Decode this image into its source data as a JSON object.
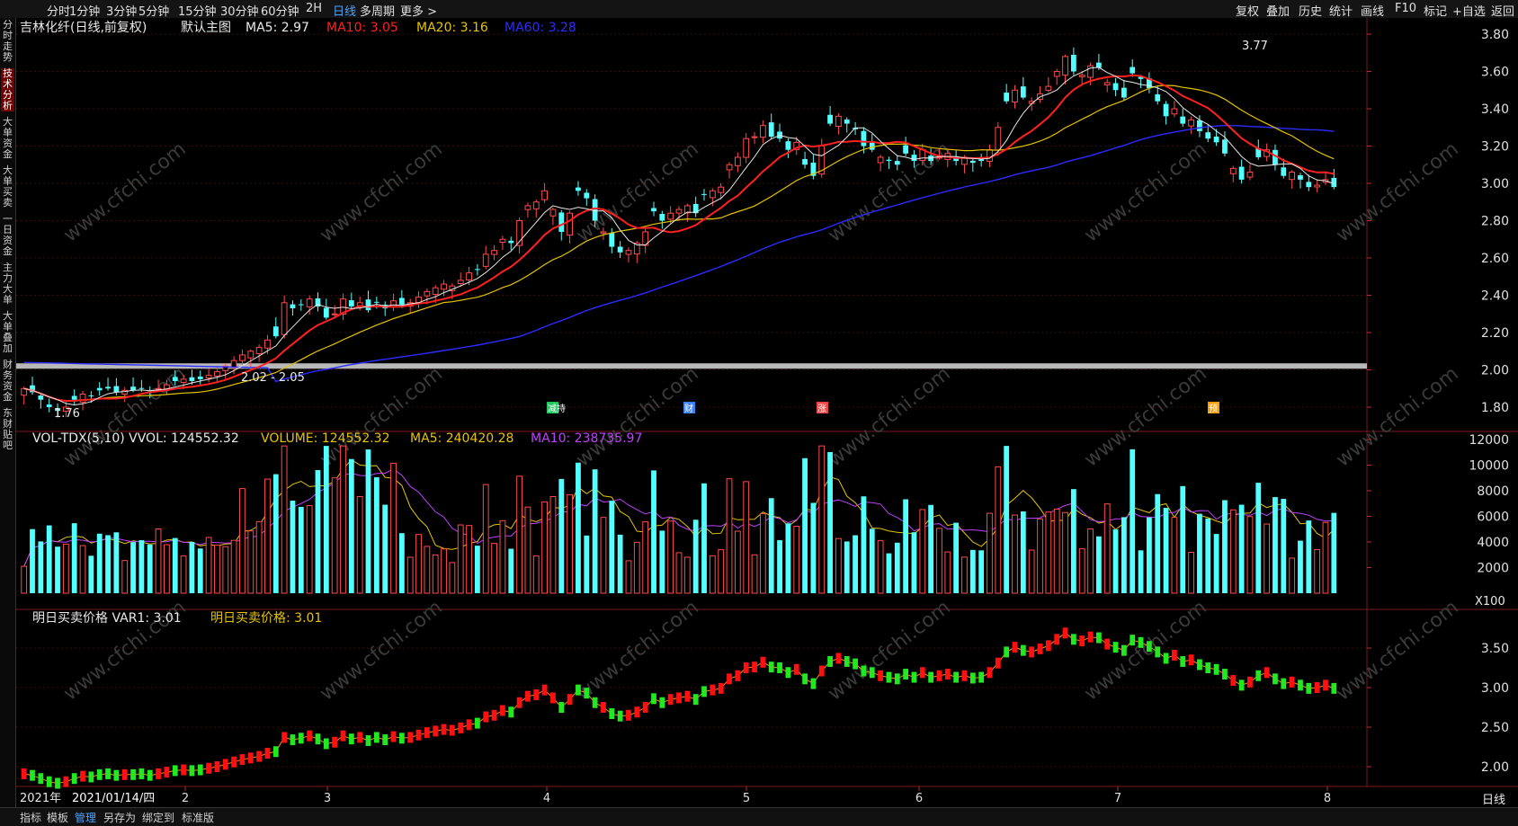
{
  "toolbar": {
    "left": [
      "分时",
      "1分钟",
      "3分钟",
      "5分钟",
      "15分钟",
      "30分钟",
      "60分钟",
      "2H",
      "日线",
      "多周期",
      "更多 >"
    ],
    "active": "日线",
    "right": [
      "复权",
      "叠加",
      "历史",
      "统计",
      "画线",
      "F10",
      "标记",
      "+自选",
      "返回"
    ]
  },
  "sidebar": {
    "tabs": [
      "分时走势",
      "技术分析",
      "大单资金",
      "大单买卖",
      "一日资金",
      "主力大单",
      "大单叠加",
      "财务资金",
      "东财贴吧"
    ],
    "active": "技术分析"
  },
  "main": {
    "stock_name": "吉林化纤(日线,前复权)",
    "template": "默认主图",
    "ma5": "MA5: 2.97",
    "ma10": "MA10: 3.05",
    "ma20": "MA20: 3.16",
    "ma60": "MA60: 3.28",
    "high_label": "3.77",
    "low_label": "1.76",
    "range_label": "2.02 - 2.05",
    "yticks": [
      "3.80",
      "3.60",
      "3.40",
      "3.20",
      "3.00",
      "2.80",
      "2.60",
      "2.40",
      "2.20",
      "2.00",
      "1.80"
    ],
    "event_markers": [
      "减持",
      "财",
      "涨",
      "预"
    ],
    "colors": {
      "ma5": "#e8e8e8",
      "ma10": "#ff2020",
      "ma20": "#e6c300",
      "ma60": "#2b2bff",
      "up": "#ff4a4a",
      "down": "#54ffff"
    }
  },
  "volume": {
    "title": "VOL-TDX(5,10) VVOL: 124552.32",
    "volume_label": "VOLUME: 124552.32",
    "ma5": "MA5: 240420.28",
    "ma10": "MA10: 238735.97",
    "yticks": [
      "12000",
      "10000",
      "8000",
      "6000",
      "4000",
      "2000"
    ],
    "unit": "X100"
  },
  "indicator": {
    "title": "明日买卖价格 VAR1: 3.01",
    "value_label": "明日买卖价格: 3.01",
    "yticks": [
      "3.50",
      "3.00",
      "2.50",
      "2.00"
    ]
  },
  "xaxis": {
    "year": "2021年",
    "cursor_date": "2021/01/14/四",
    "months": [
      "2",
      "3",
      "4",
      "5",
      "6",
      "7",
      "8"
    ],
    "period": "日线"
  },
  "bottom_tabs": [
    "指标",
    "模板",
    "管理",
    "另存为",
    "绑定到",
    "标准版"
  ],
  "bottom_active": "管理",
  "watermark": "www.cfchi.com",
  "chart_data": {
    "type": "candlestick",
    "title": "吉林化纤(日线,前复权)",
    "close": [
      1.9,
      1.88,
      1.84,
      1.8,
      1.78,
      1.8,
      1.84,
      1.87,
      1.86,
      1.89,
      1.9,
      1.88,
      1.89,
      1.89,
      1.9,
      1.88,
      1.9,
      1.92,
      1.94,
      1.95,
      1.94,
      1.95,
      1.97,
      1.99,
      2.02,
      2.05,
      2.08,
      2.1,
      2.12,
      2.16,
      2.18,
      2.36,
      2.33,
      2.35,
      2.38,
      2.34,
      2.28,
      2.3,
      2.38,
      2.34,
      2.36,
      2.32,
      2.36,
      2.33,
      2.37,
      2.35,
      2.36,
      2.39,
      2.42,
      2.44,
      2.46,
      2.45,
      2.48,
      2.52,
      2.54,
      2.62,
      2.64,
      2.7,
      2.68,
      2.8,
      2.88,
      2.9,
      2.96,
      2.86,
      2.74,
      2.84,
      2.96,
      2.92,
      2.8,
      2.74,
      2.66,
      2.63,
      2.64,
      2.68,
      2.74,
      2.85,
      2.8,
      2.84,
      2.86,
      2.88,
      2.84,
      2.94,
      2.96,
      2.98,
      3.1,
      3.14,
      3.24,
      3.25,
      3.31,
      3.25,
      3.24,
      3.18,
      3.22,
      3.1,
      3.04,
      3.2,
      3.32,
      3.36,
      3.32,
      3.29,
      3.2,
      3.18,
      3.14,
      3.12,
      3.1,
      3.16,
      3.12,
      3.18,
      3.12,
      3.14,
      3.16,
      3.12,
      3.14,
      3.11,
      3.12,
      3.18,
      3.3,
      3.44,
      3.5,
      3.46,
      3.44,
      3.48,
      3.52,
      3.6,
      3.68,
      3.6,
      3.58,
      3.63,
      3.62,
      3.54,
      3.5,
      3.46,
      3.59,
      3.56,
      3.51,
      3.44,
      3.36,
      3.4,
      3.32,
      3.34,
      3.28,
      3.24,
      3.22,
      3.16,
      3.08,
      3.02,
      3.06,
      3.14,
      3.18,
      3.1,
      3.04,
      3.06,
      3.02,
      2.98,
      2.99,
      3.02,
      2.98
    ]
  }
}
